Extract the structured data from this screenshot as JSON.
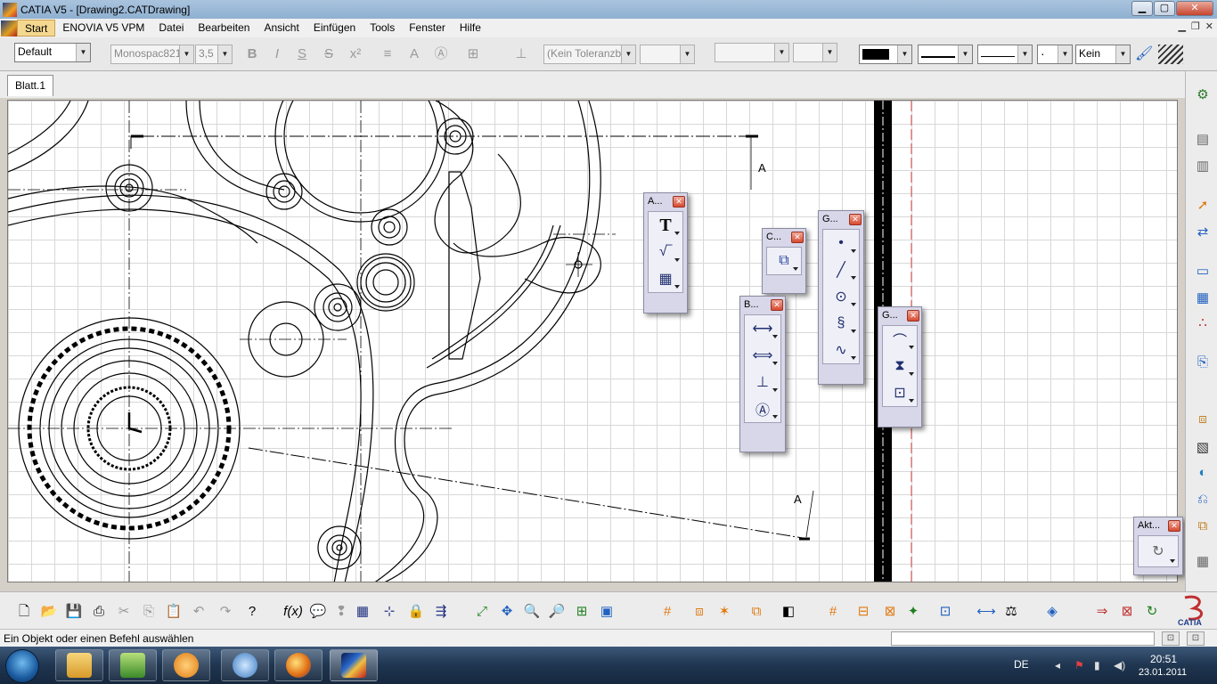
{
  "window": {
    "title": "CATIA V5 - [Drawing2.CATDrawing]"
  },
  "menu": {
    "items": [
      "Start",
      "ENOVIA V5 VPM",
      "Datei",
      "Bearbeiten",
      "Ansicht",
      "Einfügen",
      "Tools",
      "Fenster",
      "Hilfe"
    ],
    "active": "Start"
  },
  "format_toolbar": {
    "style": "Default",
    "font": "Monospac821",
    "font_size": "3,5",
    "tolerance": "(Kein Toleranzb",
    "line_value": "Kein"
  },
  "sheet_tab": {
    "label": "Blatt.1"
  },
  "drawing": {
    "section_label_top": "A",
    "section_label_bottom": "A"
  },
  "palettes": [
    {
      "title": "A..."
    },
    {
      "title": "C..."
    },
    {
      "title": "G..."
    },
    {
      "title": "B..."
    },
    {
      "title": "G..."
    },
    {
      "title": "Akt..."
    }
  ],
  "status": {
    "message": "Ein Objekt oder einen Befehl auswählen",
    "command_input": ""
  },
  "taskbar": {
    "language": "DE",
    "time": "20:51",
    "date": "23.01.2011"
  },
  "icons": {
    "title": "catia-app-icon",
    "colors": {
      "accent_orange": "#e07a10",
      "palette_bg": "#d7d7e9",
      "taskbar": "#1f3550"
    }
  }
}
